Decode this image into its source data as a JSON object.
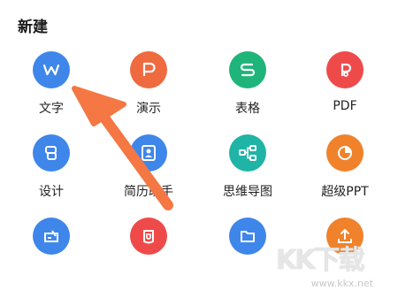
{
  "section_title": "新建",
  "items": [
    {
      "label": "文字",
      "icon": "writer-w-icon",
      "color": "#3f86ea"
    },
    {
      "label": "演示",
      "icon": "presentation-p-icon",
      "color": "#f06a3f"
    },
    {
      "label": "表格",
      "icon": "spreadsheet-s-icon",
      "color": "#1fb47a"
    },
    {
      "label": "PDF",
      "icon": "pdf-icon",
      "color": "#ef4a4a"
    },
    {
      "label": "设计",
      "icon": "design-icon",
      "color": "#3f86ea"
    },
    {
      "label": "简历助手",
      "icon": "resume-icon",
      "color": "#3f86ea"
    },
    {
      "label": "思维导图",
      "icon": "mindmap-icon",
      "color": "#1fb4a6"
    },
    {
      "label": "超级PPT",
      "icon": "super-ppt-icon",
      "color": "#f0822b"
    },
    {
      "label": "",
      "icon": "form-icon",
      "color": "#3f86ea"
    },
    {
      "label": "",
      "icon": "collect-icon",
      "color": "#ef4a4a"
    },
    {
      "label": "",
      "icon": "folder-icon",
      "color": "#3f86ea"
    },
    {
      "label": "",
      "icon": "upload-icon",
      "color": "#f0822b"
    }
  ],
  "watermark": {
    "logo_text": "KK下载",
    "url": "www.kkx.net"
  }
}
